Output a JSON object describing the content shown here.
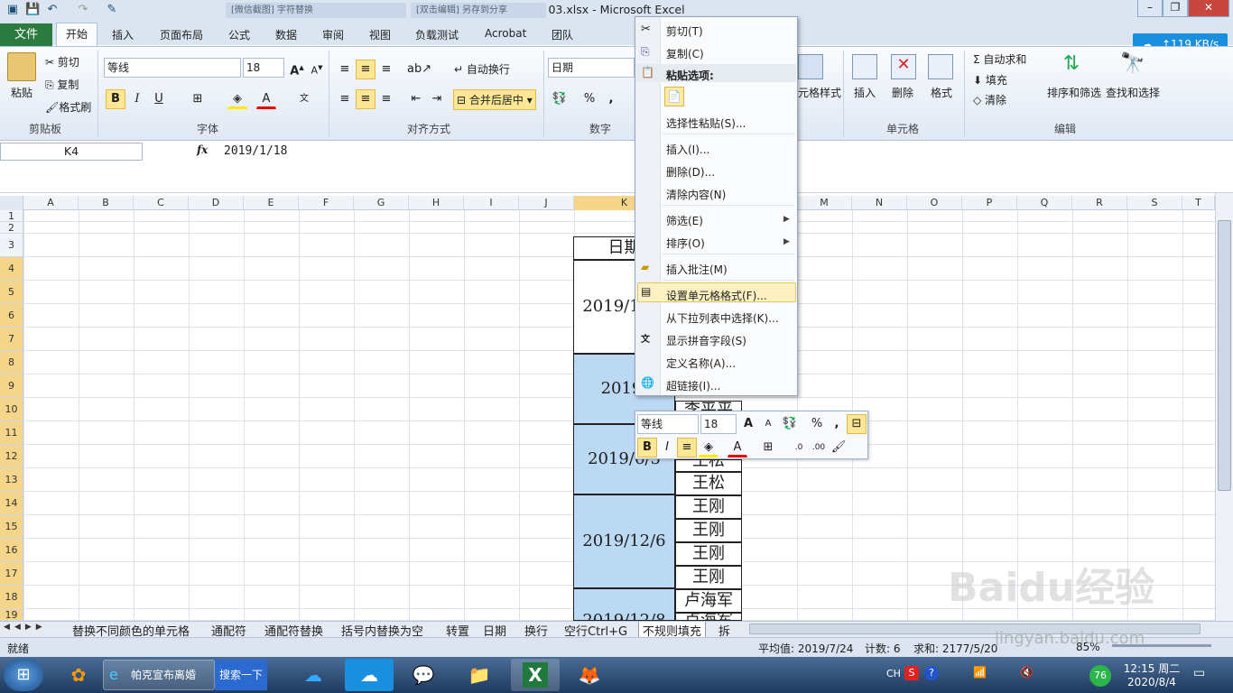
{
  "window": {
    "title": "03.xlsx - Microsoft Excel",
    "inactive_tab_1": "[微信截图] 字符替换",
    "inactive_tab_2": "[双击编辑] 另存到分享"
  },
  "tabs": {
    "file": "文件",
    "items": [
      "开始",
      "插入",
      "页面布局",
      "公式",
      "数据",
      "审阅",
      "视图",
      "负载测试",
      "Acrobat",
      "团队"
    ]
  },
  "net_speed": "↑119 KB/s",
  "ribbon": {
    "clipboard": {
      "paste": "粘贴",
      "cut": "剪切",
      "copy": "复制",
      "format_painter": "格式刷",
      "label": "剪贴板"
    },
    "font": {
      "name": "等线",
      "size": "18",
      "bold": "B",
      "italic": "I",
      "underline": "U",
      "label": "字体"
    },
    "alignment": {
      "wrap": "自动换行",
      "merge": "合并后居中",
      "label": "对齐方式"
    },
    "number": {
      "format": "日期",
      "percent": "%",
      "comma": ",",
      "label": "数字"
    },
    "styles": {
      "cell_styles": "元格样式"
    },
    "cells": {
      "insert": "插入",
      "delete": "删除",
      "format": "格式",
      "label": "单元格"
    },
    "editing": {
      "autosum": "Σ 自动求和",
      "fill": "填充",
      "clear": "清除",
      "sort_filter": "排序和筛选",
      "find_select": "查找和选择",
      "label": "编辑"
    }
  },
  "formula_bar": {
    "name_box": "K4",
    "fx": "fx",
    "content": "2019/1/18"
  },
  "columns": [
    "A",
    "B",
    "C",
    "D",
    "E",
    "F",
    "G",
    "H",
    "I",
    "J",
    "K",
    "",
    "M",
    "N",
    "O",
    "P",
    "Q",
    "R",
    "S",
    "T",
    "U"
  ],
  "rows": [
    "1",
    "2",
    "3",
    "4",
    "5",
    "6",
    "7",
    "8",
    "9",
    "10",
    "11",
    "12",
    "13",
    "14",
    "15",
    "16",
    "17",
    "18",
    "19"
  ],
  "sheet": {
    "header_date": "日期",
    "dates": [
      "2019/1/18",
      "2019/",
      "2019/6/5",
      "2019/12/6",
      "2019/12/8"
    ],
    "names": [
      "李平平",
      "王松",
      "王松",
      "王刚",
      "王刚",
      "王刚",
      "王刚",
      "卢海军",
      "卢海军"
    ]
  },
  "context_menu": {
    "cut": "剪切(T)",
    "copy": "复制(C)",
    "paste_options": "粘贴选项:",
    "paste_special": "选择性粘贴(S)...",
    "insert": "插入(I)...",
    "delete": "删除(D)...",
    "clear": "清除内容(N)",
    "filter": "筛选(E)",
    "sort": "排序(O)",
    "insert_comment": "插入批注(M)",
    "format_cells": "设置单元格格式(F)...",
    "pick_list": "从下拉列表中选择(K)...",
    "phonetic": "显示拼音字段(S)",
    "define_name": "定义名称(A)...",
    "hyperlink": "超链接(I)..."
  },
  "mini_toolbar": {
    "font": "等线",
    "size": "18",
    "percent": "%",
    "comma": ","
  },
  "sheet_tabs": [
    "替换不同颜色的单元格",
    "通配符",
    "通配符替换",
    "括号内替换为空",
    "转置",
    "日期",
    "换行",
    "空行Ctrl+G",
    "不规则填充",
    "拆"
  ],
  "status": {
    "ready": "就绪",
    "average": "平均值: 2019/7/24",
    "count": "计数: 6",
    "sum": "求和: 2177/5/20",
    "zoom": "85%"
  },
  "taskbar": {
    "ie_label": "帕克宣布离婚",
    "search_label": "搜索一下",
    "tray_text": "CH",
    "badge": "76",
    "time": "12:15 周二",
    "date": "2020/8/4"
  },
  "watermark": "Baidu经验",
  "watermark_url": "jingyan.baidu.com"
}
